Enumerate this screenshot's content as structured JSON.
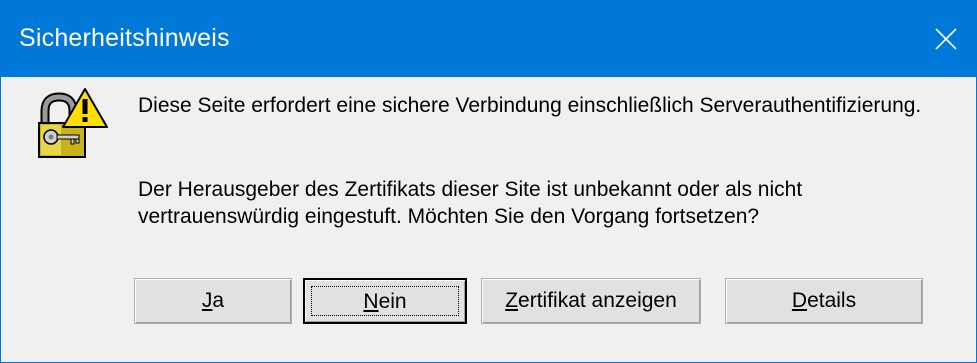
{
  "window": {
    "title": "Sicherheitshinweis",
    "close_icon": "close-icon",
    "accent_color": "#0078d7"
  },
  "message": {
    "icon": "warning-lock-icon",
    "line1": "Diese Seite erfordert eine sichere Verbindung einschließlich Serverauthentifizierung.",
    "line2a": "Der Herausgeber des Zertifikats dieser Site ist unbekannt oder als nicht",
    "line2b": "vertrauenswürdig eingestuft. Möchten Sie den Vorgang fortsetzen?"
  },
  "buttons": {
    "yes": {
      "accel": "J",
      "rest": "a"
    },
    "no": {
      "accel": "N",
      "rest": "ein"
    },
    "cert": {
      "accel": "Z",
      "rest": "ertifikat anzeigen"
    },
    "details": {
      "accel": "D",
      "rest": "etails"
    }
  }
}
